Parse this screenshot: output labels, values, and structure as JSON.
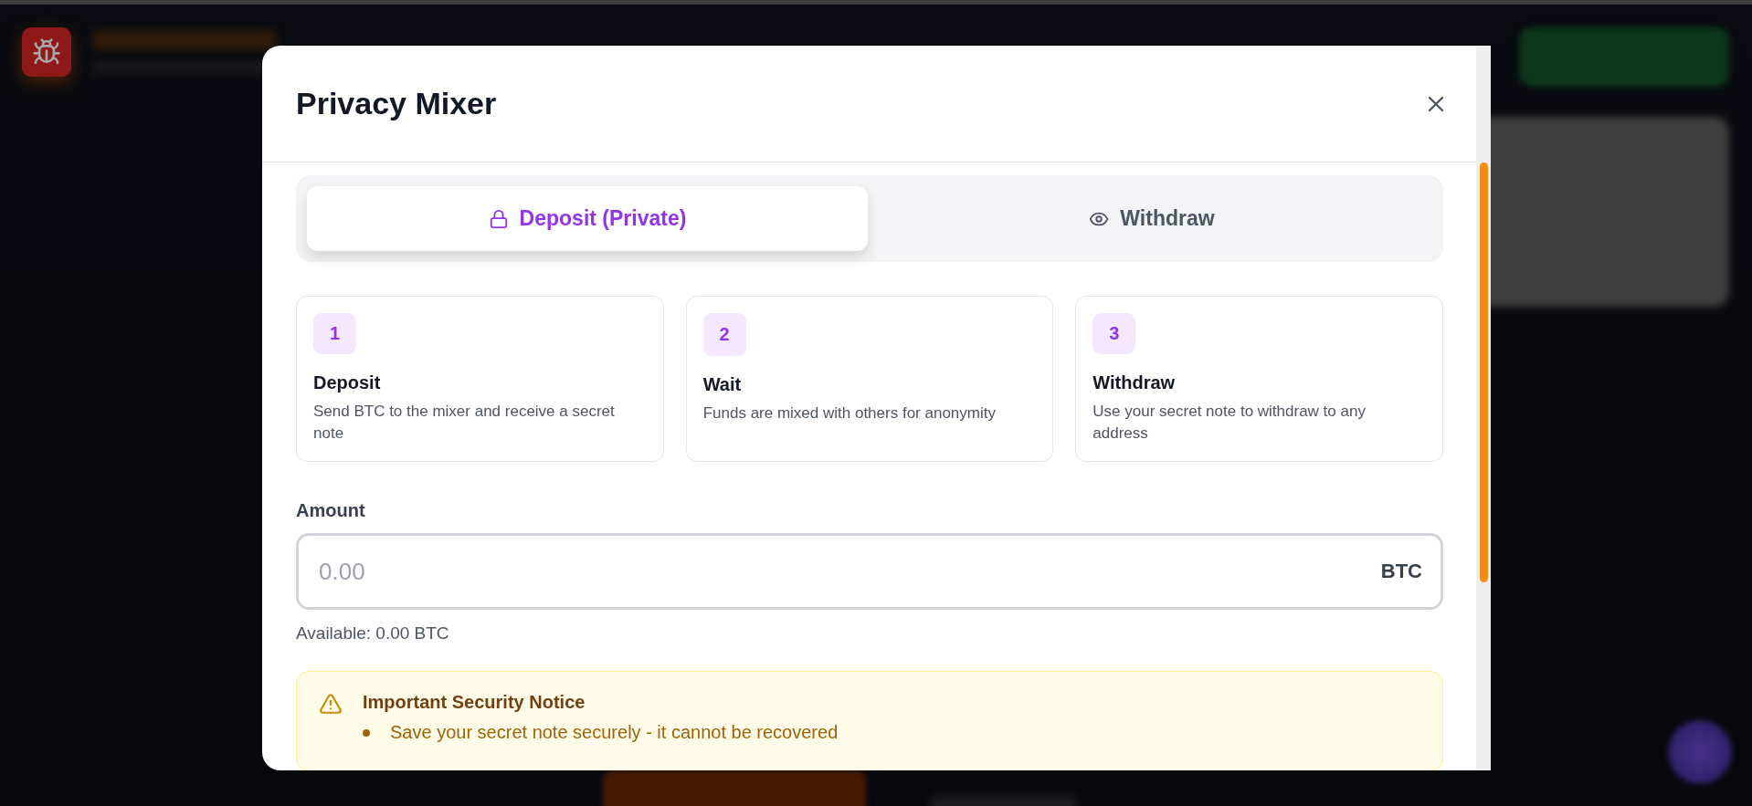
{
  "dialog": {
    "title": "Privacy Mixer"
  },
  "tabs": [
    {
      "label": "Deposit (Private)",
      "selected": true
    },
    {
      "label": "Withdraw",
      "selected": false
    }
  ],
  "steps": [
    {
      "number": "1",
      "title": "Deposit",
      "description": "Send BTC to the mixer and receive a secret note"
    },
    {
      "number": "2",
      "title": "Wait",
      "description": "Funds are mixed with others for anonymity"
    },
    {
      "number": "3",
      "title": "Withdraw",
      "description": "Use your secret note to withdraw to any address"
    }
  ],
  "amount": {
    "label": "Amount",
    "placeholder": "0.00",
    "unit": "BTC"
  },
  "available": "Available: 0.00 BTC",
  "notice": {
    "title": "Important Security Notice",
    "items": [
      "Save your secret note securely - it cannot be recovered"
    ]
  }
}
